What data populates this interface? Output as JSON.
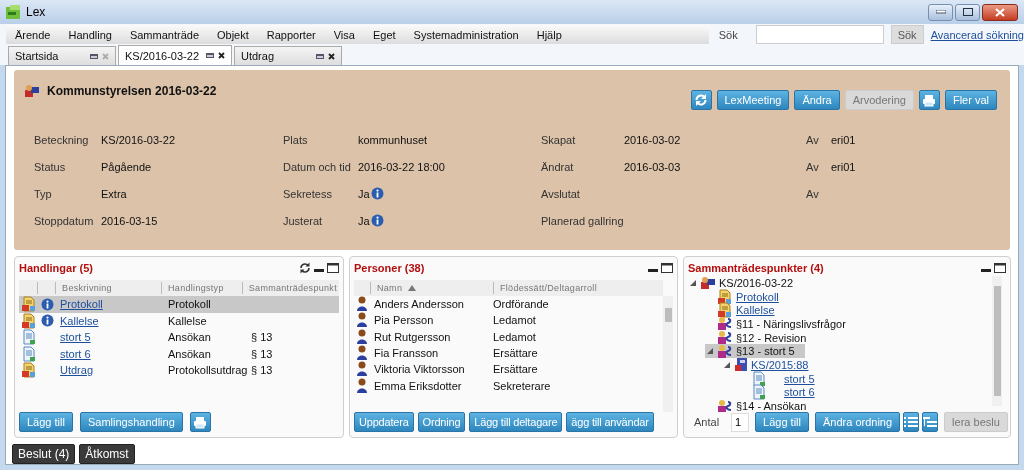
{
  "window": {
    "title": "Lex"
  },
  "menu": [
    "Ärende",
    "Handling",
    "Sammanträde",
    "Objekt",
    "Rapporter",
    "Visa",
    "Eget",
    "Systemadministration",
    "Hjälp"
  ],
  "search": {
    "label": "Sök",
    "button": "Sök",
    "link": "Avancerad sökning"
  },
  "tabs": [
    {
      "label": "Startsida",
      "selected": false,
      "close_enabled": false
    },
    {
      "label": "KS/2016-03-22",
      "selected": true,
      "close_enabled": true
    },
    {
      "label": "Utdrag",
      "selected": false,
      "close_enabled": true
    }
  ],
  "meeting": {
    "title": "Kommunstyrelsen 2016-03-22",
    "buttons": [
      {
        "kind": "refresh",
        "disabled": false
      },
      {
        "kind": "text",
        "label": "LexMeeting",
        "disabled": false
      },
      {
        "kind": "text",
        "label": "Ändra",
        "disabled": false
      },
      {
        "kind": "text",
        "label": "Arvodering",
        "disabled": true
      },
      {
        "kind": "print",
        "disabled": false
      },
      {
        "kind": "text",
        "label": "Fler val",
        "disabled": false
      }
    ],
    "columns": [
      [
        {
          "label": "Beteckning",
          "value": "KS/2016-03-22"
        },
        {
          "label": "Status",
          "value": "Pågående"
        },
        {
          "label": "Typ",
          "value": "Extra"
        },
        {
          "label": "Stoppdatum",
          "value": "2016-03-15"
        }
      ],
      [
        {
          "label": "Plats",
          "value": "kommunhuset"
        },
        {
          "label": "Datum och tid",
          "value": "2016-03-22 18:00"
        },
        {
          "label": "Sekretess",
          "value": "Ja",
          "info": true
        },
        {
          "label": "Justerat",
          "value": "Ja",
          "info": true
        }
      ],
      [
        {
          "label": "Skapat",
          "value": "2016-03-02"
        },
        {
          "label": "Ändrat",
          "value": "2016-03-03"
        },
        {
          "label": "Avslutat"
        },
        {
          "label": "Planerad gallring"
        }
      ],
      [
        {
          "label": "Av",
          "value": "eri01"
        },
        {
          "label": "Av",
          "value": "eri01"
        },
        {
          "label": "Av"
        }
      ]
    ]
  },
  "documents": {
    "title": "Handlingar (5)",
    "columns": [
      "Beskrivning",
      "Handlingstyp",
      "Sammanträdespunkt"
    ],
    "rows": [
      {
        "kind": "protocol",
        "info": true,
        "description": "Protokoll",
        "type": "Protokoll",
        "selected": true
      },
      {
        "kind": "protocol",
        "info": true,
        "description": "Kallelse",
        "type": "Kallelse",
        "selected": false
      },
      {
        "kind": "document",
        "info": false,
        "description": "stort 5",
        "type": "Ansökan",
        "point": "§ 13",
        "selected": false
      },
      {
        "kind": "document",
        "info": false,
        "description": "stort 6",
        "type": "Ansökan",
        "point": "§ 13",
        "selected": false
      },
      {
        "kind": "protocol",
        "info": false,
        "description": "Utdrag",
        "type": "Protokollsutdrag",
        "point": "§ 13",
        "selected": false
      }
    ],
    "buttons": [
      {
        "kind": "text",
        "label": "Lägg till",
        "disabled": false
      },
      {
        "kind": "text",
        "label": "Samlingshandling",
        "disabled": false
      },
      {
        "kind": "print",
        "disabled": false
      }
    ]
  },
  "persons": {
    "title": "Personer (38)",
    "columns": [
      {
        "label": "Namn",
        "sorted_ascending": true
      },
      {
        "label": "Flödessätt/Deltagarroll"
      }
    ],
    "rows": [
      {
        "name": "Anders Andersson",
        "role": "Ordförande"
      },
      {
        "name": "Pia Persson",
        "role": "Ledamot"
      },
      {
        "name": "Rut Rutgersson",
        "role": "Ledamot"
      },
      {
        "name": "Fia Fransson",
        "role": "Ersättare"
      },
      {
        "name": "Viktoria Viktorsson",
        "role": "Ersättare"
      },
      {
        "name": "Emma Eriksdotter",
        "role": "Sekreterare"
      }
    ],
    "buttons": [
      {
        "kind": "text",
        "label": "Uppdatera",
        "disabled": false
      },
      {
        "kind": "text",
        "label": "Ordning",
        "disabled": false
      },
      {
        "kind": "text",
        "label": "Lägg till deltagare",
        "disabled": false
      },
      {
        "kind": "text",
        "label": "ägg till användar",
        "disabled": false
      }
    ]
  },
  "agenda": {
    "title": "Sammanträdespunkter (4)",
    "tree": [
      {
        "kind": "meeting",
        "text": "KS/2016-03-22",
        "link": false,
        "selected": false,
        "expanded": true,
        "children": [
          {
            "kind": "protocol",
            "text": "Protokoll",
            "link": true,
            "selected": false
          },
          {
            "kind": "protocol",
            "text": "Kallelse",
            "link": true,
            "selected": false
          },
          {
            "kind": "item",
            "text": "§11 - Näringslivsfrågor",
            "link": false,
            "selected": false
          },
          {
            "kind": "item",
            "text": "§12 - Revision",
            "link": false,
            "selected": false
          },
          {
            "kind": "item",
            "text": "§13 - stort 5",
            "link": false,
            "selected": true,
            "expanded": true,
            "children": [
              {
                "kind": "case",
                "text": "KS/2015:88",
                "link": true,
                "selected": false,
                "expanded": true,
                "children": [
                  {
                    "kind": "document",
                    "text": "stort 5",
                    "link": true,
                    "selected": false
                  },
                  {
                    "kind": "document",
                    "text": "stort 6",
                    "link": true,
                    "selected": false
                  }
                ]
              }
            ]
          },
          {
            "kind": "item",
            "text": "§14 - Ansökan",
            "link": false,
            "selected": false
          }
        ]
      }
    ],
    "count_label": "Antal",
    "count": "1",
    "buttons": [
      {
        "kind": "text",
        "label": "Lägg till",
        "disabled": false
      },
      {
        "kind": "text",
        "label": "Ändra ordning",
        "disabled": false
      },
      {
        "kind": "list",
        "disabled": false
      },
      {
        "kind": "tree",
        "disabled": false
      },
      {
        "kind": "text",
        "label": "lera beslu",
        "disabled": true
      }
    ]
  },
  "bottom_tabs": [
    {
      "label": "Beslut (4)"
    },
    {
      "label": "Åtkomst"
    }
  ]
}
